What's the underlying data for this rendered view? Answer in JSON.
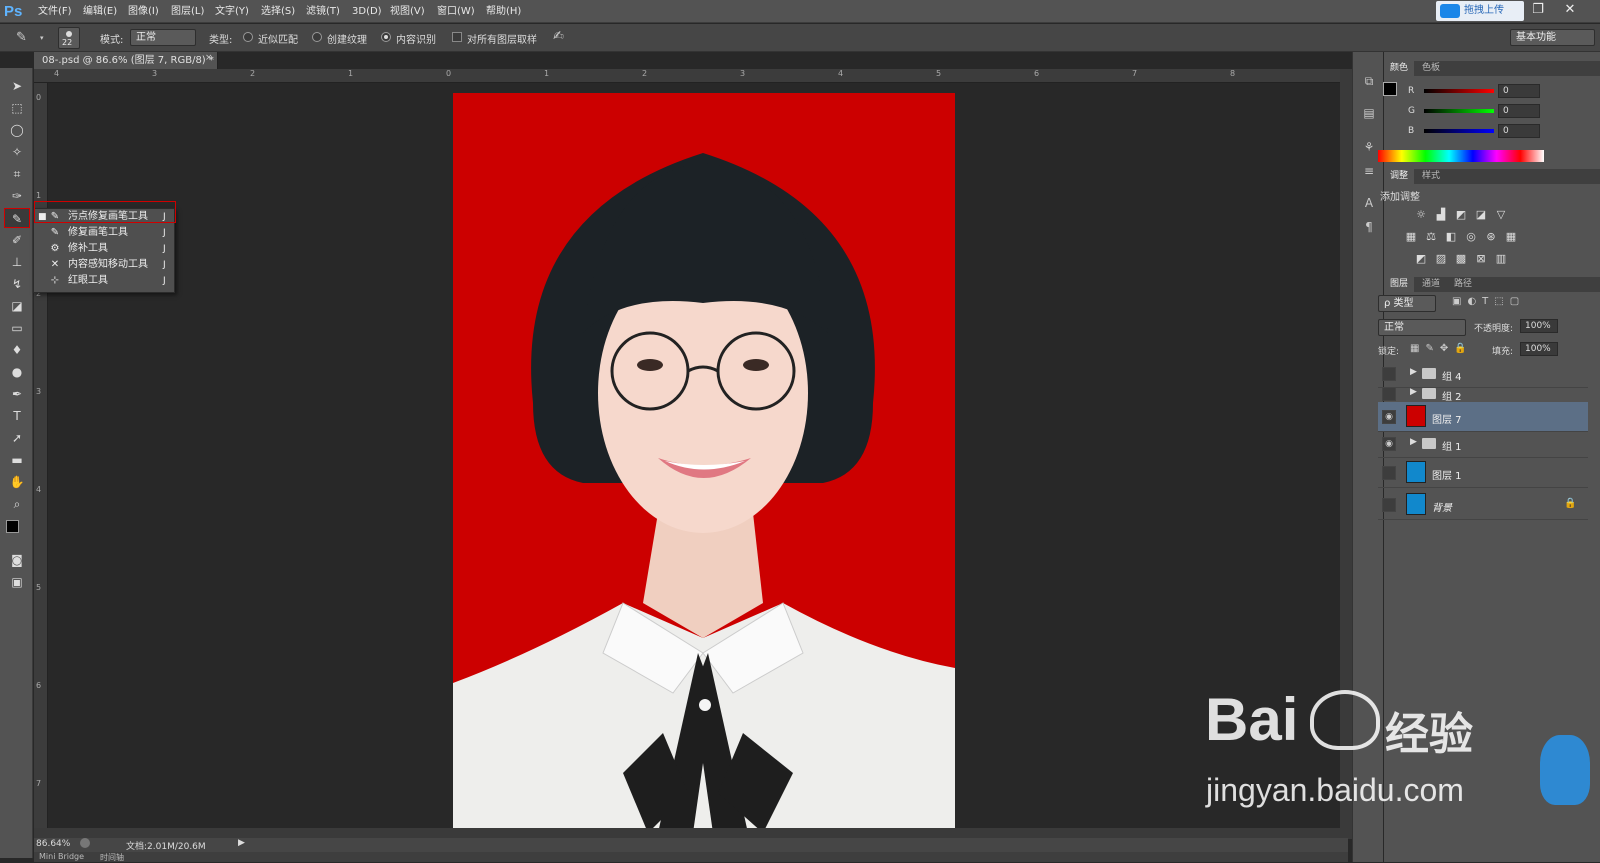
{
  "app": {
    "logo": "Ps"
  },
  "menu": [
    "文件(F)",
    "编辑(E)",
    "图像(I)",
    "图层(L)",
    "文字(Y)",
    "选择(S)",
    "滤镜(T)",
    "3D(D)",
    "视图(V)",
    "窗口(W)",
    "帮助(H)"
  ],
  "upload": {
    "label": "拖拽上传"
  },
  "options": {
    "brush_size": "22",
    "mode_label": "模式:",
    "mode_value": "正常",
    "type_label": "类型:",
    "type_options": [
      "近似匹配",
      "创建纹理",
      "内容识别"
    ],
    "type_selected": "内容识别",
    "sample_all_label": "对所有图层取样",
    "workspace": "基本功能"
  },
  "document": {
    "tab_title": "08-.psd @ 86.6% (图层 7, RGB/8) *",
    "zoom": "86.64%",
    "doc_info": "文档:2.01M/20.6M"
  },
  "ruler": {
    "h_ticks": [
      "4",
      "3",
      "2",
      "1",
      "0",
      "1",
      "2",
      "3",
      "4",
      "5",
      "6",
      "7",
      "8"
    ],
    "v_ticks": [
      "0",
      "1",
      "2",
      "3",
      "4",
      "5",
      "6",
      "7"
    ]
  },
  "tool_flyout": {
    "items": [
      {
        "label": "污点修复画笔工具",
        "key": "J",
        "active": true,
        "icon": "spot-healing-icon"
      },
      {
        "label": "修复画笔工具",
        "key": "J",
        "active": false,
        "icon": "healing-brush-icon"
      },
      {
        "label": "修补工具",
        "key": "J",
        "active": false,
        "icon": "patch-icon"
      },
      {
        "label": "内容感知移动工具",
        "key": "J",
        "active": false,
        "icon": "content-aware-move-icon"
      },
      {
        "label": "红眼工具",
        "key": "J",
        "active": false,
        "icon": "red-eye-icon"
      }
    ]
  },
  "color_panel": {
    "tabs": [
      "颜色",
      "色板"
    ],
    "channels": [
      {
        "name": "R",
        "value": "0"
      },
      {
        "name": "G",
        "value": "0"
      },
      {
        "name": "B",
        "value": "0"
      }
    ]
  },
  "adjustments_panel": {
    "tabs": [
      "调整",
      "样式"
    ],
    "title": "添加调整"
  },
  "layers_panel": {
    "tabs": [
      "图层",
      "通道",
      "路径"
    ],
    "filter_label": "ρ 类型",
    "blend_mode": "正常",
    "opacity_label": "不透明度:",
    "opacity": "100%",
    "lock_label": "锁定:",
    "fill_label": "填充:",
    "fill": "100%",
    "layers": [
      {
        "name": "组 4",
        "type": "group",
        "visible": false,
        "selected": false
      },
      {
        "name": "组 2",
        "type": "group",
        "visible": false,
        "selected": false
      },
      {
        "name": "图层 7",
        "type": "layer",
        "visible": true,
        "selected": true,
        "thumb_bg": "#cc0000"
      },
      {
        "name": "组 1",
        "type": "group",
        "visible": true,
        "selected": false
      },
      {
        "name": "图层 1",
        "type": "layer",
        "visible": false,
        "selected": false,
        "thumb_bg": "#1188cc"
      },
      {
        "name": "背景",
        "type": "background",
        "visible": false,
        "selected": false,
        "thumb_bg": "#1188cc"
      }
    ]
  },
  "bottom_tabs": [
    "Mini Bridge",
    "时间轴"
  ],
  "watermark": {
    "brand": "Bai",
    "brand2": "经验",
    "url": "jingyan.baidu.com"
  },
  "colors": {
    "photo_bg": "#cc0000",
    "selected_layer": "#5c6f86",
    "flyout_highlight": "#d00000"
  }
}
